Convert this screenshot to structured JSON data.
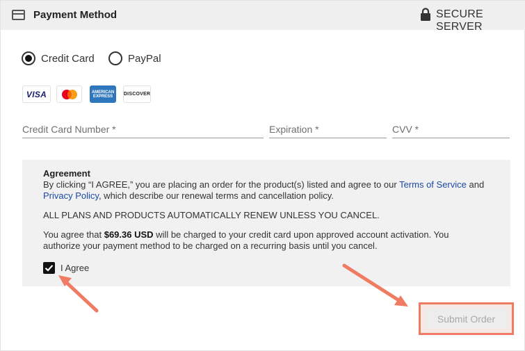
{
  "header": {
    "title": "Payment Method",
    "secure_label": "SECURE SERVER"
  },
  "payment_options": [
    {
      "label": "Credit Card",
      "selected": true
    },
    {
      "label": "PayPal",
      "selected": false
    }
  ],
  "card_logos": {
    "visa": "VISA",
    "amex_line1": "AMERICAN",
    "amex_line2": "EXPRESS",
    "discover": "DISCOVER"
  },
  "fields": {
    "card_number_placeholder": "Credit Card Number *",
    "expiration_placeholder": "Expiration *",
    "cvv_placeholder": "CVV *"
  },
  "agreement": {
    "title": "Agreement",
    "text1_pre": "By clicking “I AGREE,” you are placing an order for the product(s) listed and agree to our ",
    "terms_link": "Terms of Service",
    "text1_mid": " and ",
    "privacy_link": "Privacy Policy",
    "text1_post": ", which describe our renewal terms and cancellation policy.",
    "renew_notice": "ALL PLANS AND PRODUCTS AUTOMATICALLY RENEW UNLESS YOU CANCEL.",
    "charge_pre": "You agree that ",
    "charge_amount": "$69.36 USD",
    "charge_post": " will be charged to your credit card upon approved account activation. You authorize your payment method to be charged on a recurring basis until you cancel.",
    "agree_label": "I Agree",
    "agree_checked": true
  },
  "submit_label": "Submit Order",
  "colors": {
    "annotation": "#ef7b63",
    "link": "#1a4aa8"
  }
}
